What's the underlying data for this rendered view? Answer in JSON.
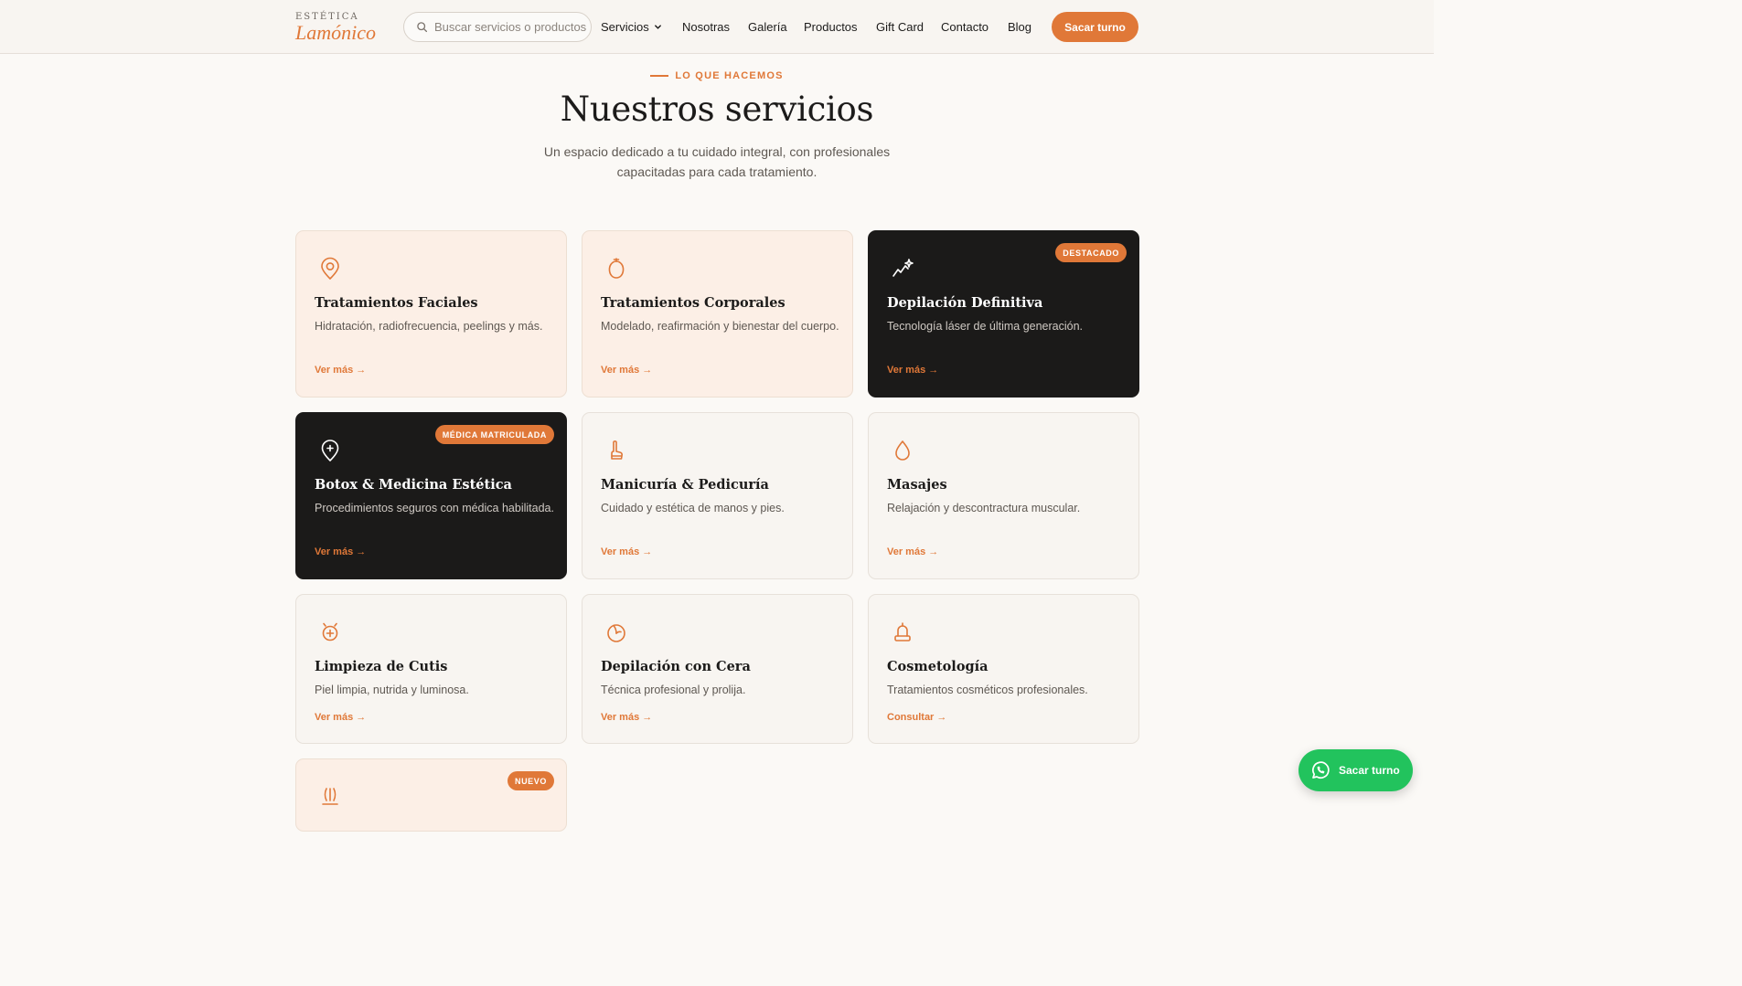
{
  "header": {
    "logo_top": "ESTÉTICA",
    "logo_main": "Lamónico",
    "search_placeholder": "Buscar servicios o productos",
    "nav": [
      {
        "label": "Servicios",
        "has_dropdown": true
      },
      {
        "label": "Nosotras"
      },
      {
        "label": "Galería"
      },
      {
        "label": "Productos"
      },
      {
        "label": "Gift Card"
      },
      {
        "label": "Contacto"
      },
      {
        "label": "Blog"
      }
    ],
    "cta_label": "Sacar turno"
  },
  "section": {
    "eyebrow": "LO QUE HACEMOS",
    "title": "Nuestros servicios",
    "subtitle": "Un espacio dedicado a tu cuidado integral, con profesionales capacitadas para cada tratamiento."
  },
  "cards": [
    {
      "title": "Tratamientos Faciales",
      "desc": "Hidratación, radiofrecuencia, peelings y más.",
      "link": "Ver más →",
      "icon": "face-icon",
      "theme": "peach"
    },
    {
      "title": "Tratamientos Corporales",
      "desc": "Modelado, reafirmación y bienestar del cuerpo.",
      "link": "Ver más →",
      "icon": "body-icon",
      "theme": "peach"
    },
    {
      "title": "Depilación Definitiva",
      "desc": "Tecnología láser de última generación.",
      "link": "Ver más →",
      "icon": "sparkle-chart-icon",
      "theme": "dark",
      "badge": "DESTACADO"
    },
    {
      "title": "Botox & Medicina Estética",
      "desc": "Procedimientos seguros con médica habilitada.",
      "link": "Ver más →",
      "icon": "medical-pin-icon",
      "theme": "dark",
      "badge": "MÉDICA MATRICULADA"
    },
    {
      "title": "Manicuría & Pedicuría",
      "desc": "Cuidado y estética de manos y pies.",
      "link": "Ver más →",
      "icon": "nail-icon",
      "theme": "light"
    },
    {
      "title": "Masajes",
      "desc": "Relajación y descontractura muscular.",
      "link": "Ver más →",
      "icon": "drop-icon",
      "theme": "light"
    },
    {
      "title": "Limpieza de Cutis",
      "desc": "Piel limpia, nutrida y luminosa.",
      "link": "Ver más →",
      "icon": "cleansing-icon",
      "theme": "light"
    },
    {
      "title": "Depilación con Cera",
      "desc": "Técnica profesional y prolija.",
      "link": "Ver más →",
      "icon": "wax-icon",
      "theme": "light"
    },
    {
      "title": "Cosmetología",
      "desc": "Tratamientos cosméticos profesionales.",
      "link": "Consultar →",
      "icon": "cosmetic-icon",
      "theme": "light"
    },
    {
      "title": "",
      "desc": "",
      "link": "",
      "icon": "sauna-icon",
      "theme": "peach",
      "badge": "NUEVO"
    }
  ],
  "whatsapp": {
    "label": "Sacar turno",
    "icon": "whatsapp-icon"
  },
  "colors": {
    "accent": "#e07838",
    "dark_card": "#1b1a19",
    "peach_card": "#fcefe6",
    "light_card": "#f8f5f1",
    "whatsapp": "#22c35d"
  }
}
